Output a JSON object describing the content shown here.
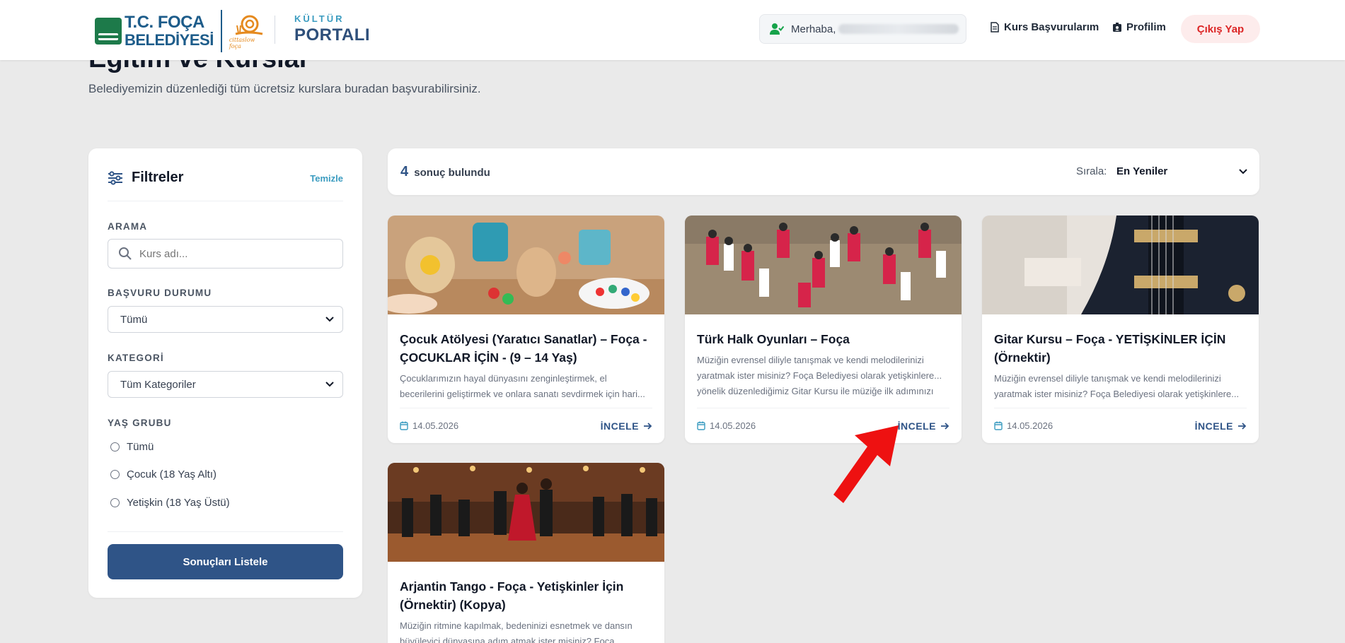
{
  "header": {
    "logo_line1": "T.C. FOÇA",
    "logo_line2": "BELEDİYESİ",
    "logo_tag": "cittaslow foça",
    "portal_small": "KÜLTÜR",
    "portal_big": "PORTALI",
    "greeting": "Merhaba,",
    "nav_applications": "Kurs Başvurularım",
    "nav_profile": "Profilim",
    "logout": "Çıkış Yap"
  },
  "hero": {
    "title": "Eğitim ve Kurslar",
    "subtitle": "Belediyemizin düzenlediği tüm ücretsiz kurslara buradan başvurabilirsiniz."
  },
  "filters": {
    "title": "Filtreler",
    "clear": "Temizle",
    "search_label": "ARAMA",
    "search_placeholder": "Kurs adı...",
    "status_label": "BAŞVURU DURUMU",
    "status_value": "Tümü",
    "category_label": "KATEGORİ",
    "category_value": "Tüm Kategoriler",
    "age_label": "YAŞ GRUBU",
    "age_options": [
      "Tümü",
      "Çocuk (18 Yaş Altı)",
      "Yetişkin (18 Yaş Üstü)"
    ],
    "submit": "Sonuçları Listele"
  },
  "results": {
    "count": "4",
    "count_label": "sonuç bulundu",
    "sort_label": "Sırala:",
    "sort_value": "En Yeniler"
  },
  "cards": [
    {
      "title": "Çocuk Atölyesi (Yaratıcı Sanatlar) – Foça - ÇOCUKLAR İÇİN - (9 – 14 Yaş)",
      "desc1": "Çocuklarımızın hayal dünyasını zenginleştirmek, el",
      "desc2": "becerilerini geliştirmek ve onlara sanatı sevdirmek için hari...",
      "desc3": "",
      "date": "14.05.2026",
      "action": "İNCELE"
    },
    {
      "title": "Türk Halk Oyunları – Foça",
      "desc1": "Müziğin evrensel diliyle tanışmak ve kendi melodilerinizi",
      "desc2": "yaratmak ister misiniz? Foça Belediyesi olarak yetişkinlere...",
      "desc3": "yönelik düzenlediğimiz Gitar Kursu ile müziğe ilk adımınızı",
      "date": "14.05.2026",
      "action": "İNCELE"
    },
    {
      "title": "Gitar Kursu – Foça - YETİŞKİNLER İÇİN (Örnektir)",
      "desc1": "Müziğin evrensel diliyle tanışmak ve kendi melodilerinizi",
      "desc2": "yaratmak ister misiniz? Foça Belediyesi olarak yetişkinlere...",
      "desc3": "",
      "date": "14.05.2026",
      "action": "İNCELE"
    },
    {
      "title": "Arjantin Tango - Foça - Yetişkinler İçin (Örnektir) (Kopya)",
      "desc1": "Müziğin ritmine kapılmak, bedeninizi esnetmek ve dansın",
      "desc2": "büyüleyici dünyasına adım atmak ister misiniz? Foça",
      "desc3": "",
      "date": "",
      "action": ""
    }
  ],
  "colors": {
    "brand_blue": "#2f5487",
    "accent_teal": "#3b9cc0",
    "logout_red": "#dc2626",
    "background": "#eaeaea"
  }
}
